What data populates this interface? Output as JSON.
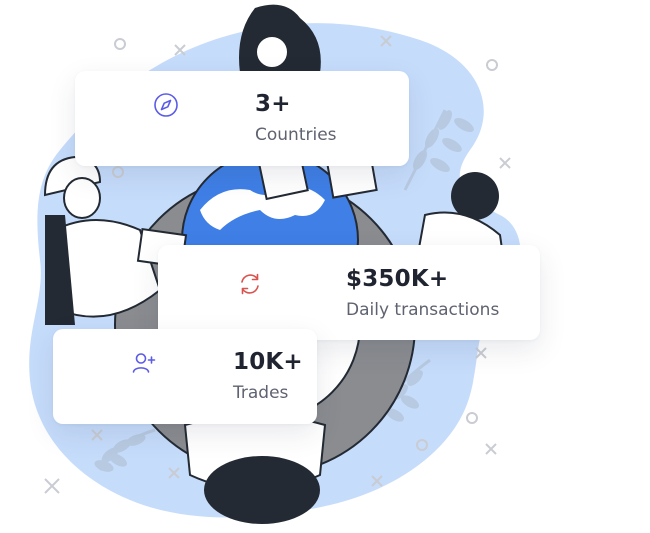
{
  "stats": [
    {
      "icon": "compass-icon",
      "value": "3+",
      "label": "Countries"
    },
    {
      "icon": "refresh-icon",
      "value": "$350K+",
      "label": "Daily transactions"
    },
    {
      "icon": "user-add-icon",
      "value": "10K+",
      "label": "Trades"
    }
  ],
  "colors": {
    "blob": "#c6dcfb",
    "globe_ocean": "#3f7fe6",
    "table_ring": "#8a8c90",
    "outline": "#232a33",
    "leaf": "#b7c9df",
    "icon_purple": "#5b5be8",
    "icon_red": "#d9534f",
    "value_text": "#1f2430",
    "label_text": "#5f6370"
  }
}
